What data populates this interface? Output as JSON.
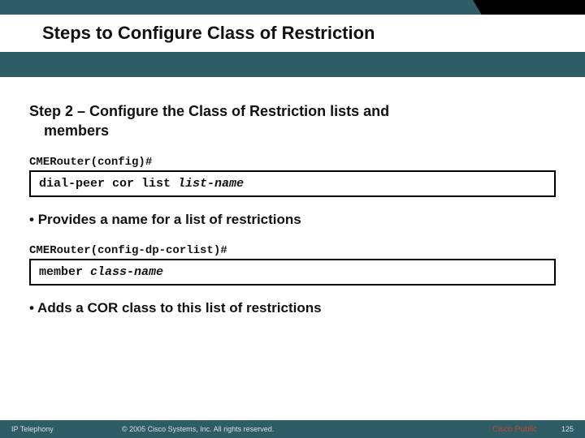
{
  "header": {
    "title": "Steps to Configure Class of Restriction"
  },
  "body": {
    "step_heading_l1": "Step 2 – Configure the Class of Restriction lists and",
    "step_heading_l2": "members",
    "prompt1": "CMERouter(config)#",
    "cmd1_text": "dial-peer cor list ",
    "cmd1_arg": "list-name",
    "bullet1": "Provides a name for a list of restrictions",
    "prompt2": "CMERouter(config-dp-corlist)#",
    "cmd2_text": "member ",
    "cmd2_arg": "class-name",
    "bullet2": "Adds a COR class to this list of restrictions"
  },
  "footer": {
    "left": "IP Telephony",
    "mid": "© 2005 Cisco Systems, Inc. All rights reserved.",
    "pub": "Cisco Public",
    "num": "125"
  }
}
